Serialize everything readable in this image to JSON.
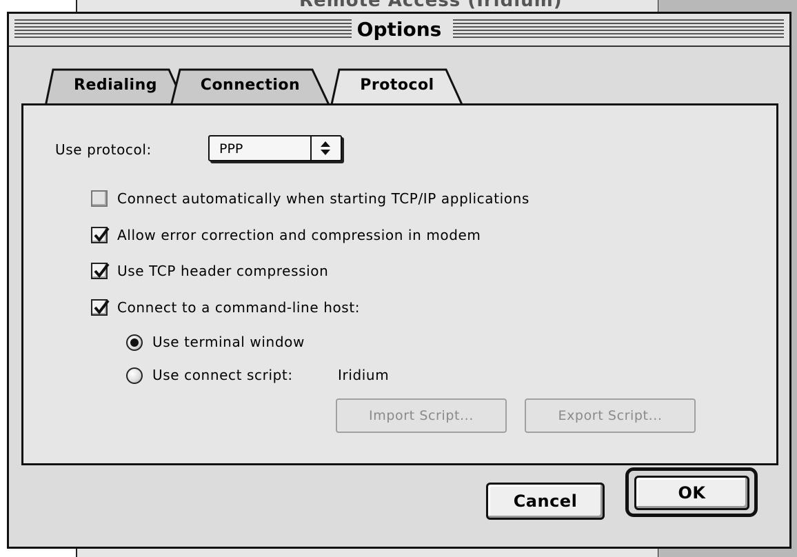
{
  "background_window": {
    "title": "Remote Access (Iridium)"
  },
  "dialog": {
    "title": "Options"
  },
  "tabs": [
    {
      "label": "Redialing",
      "active": false
    },
    {
      "label": "Connection",
      "active": false
    },
    {
      "label": "Protocol",
      "active": true
    }
  ],
  "protocol": {
    "use_protocol_label": "Use protocol:",
    "protocol_value": "PPP",
    "options": [
      {
        "label": "Connect automatically when starting TCP/IP applications",
        "checked": false
      },
      {
        "label": "Allow error correction and compression in modem",
        "checked": true
      },
      {
        "label": "Use TCP header compression",
        "checked": true
      },
      {
        "label": "Connect to a command-line host:",
        "checked": true
      }
    ],
    "host_modes": [
      {
        "label": "Use terminal window",
        "selected": true
      },
      {
        "label": "Use connect script:",
        "selected": false,
        "value": "Iridium"
      }
    ],
    "import_script_label": "Import Script...",
    "export_script_label": "Export Script..."
  },
  "buttons": {
    "cancel_label": "Cancel",
    "ok_label": "OK"
  }
}
